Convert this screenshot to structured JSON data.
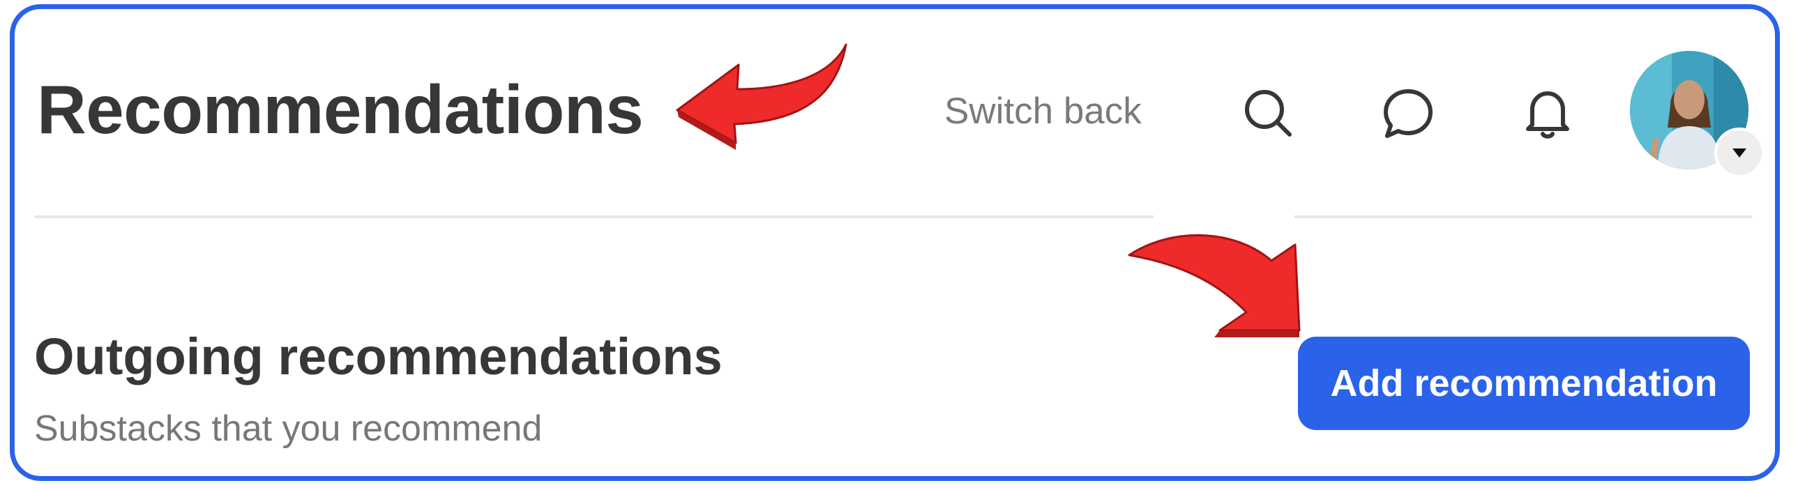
{
  "header": {
    "title": "Recommendations",
    "switch_back_label": "Switch back",
    "icons": [
      "search-icon",
      "chat-icon",
      "bell-icon"
    ],
    "avatar_menu_icon": "caret-down-icon"
  },
  "section": {
    "title": "Outgoing recommendations",
    "subtitle": "Substacks that you recommend",
    "add_button_label": "Add recommendation"
  },
  "annotations": {
    "arrow_color": "#ee2a2a",
    "arrows": [
      "curved-arrow-pointing-to-title",
      "curved-arrow-pointing-to-add-button"
    ]
  },
  "colors": {
    "accent": "#2a62ea",
    "title_text": "#363737",
    "muted_text": "#777777"
  }
}
